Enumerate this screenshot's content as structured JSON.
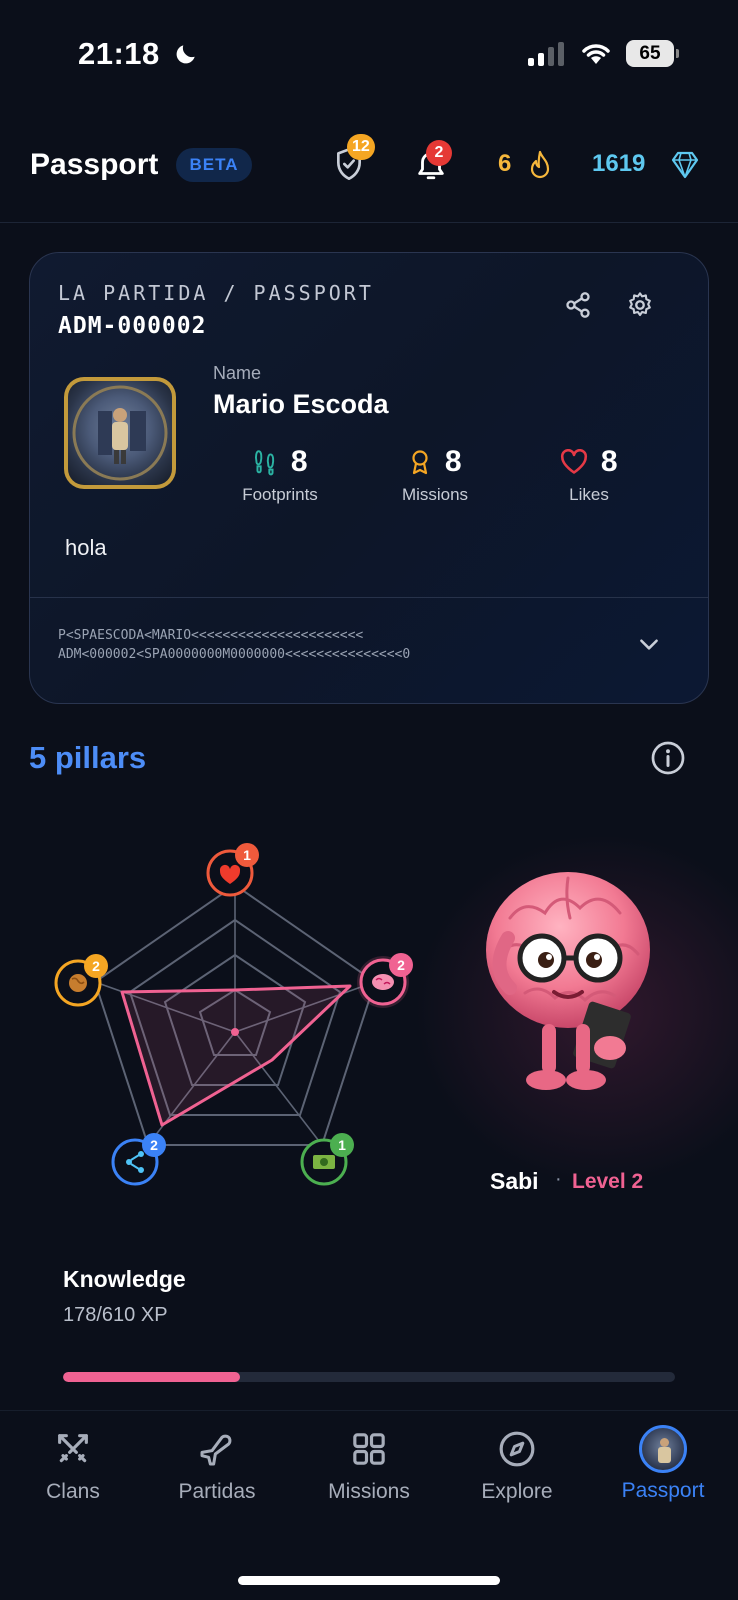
{
  "status_bar": {
    "time": "21:18",
    "battery": "65"
  },
  "header": {
    "title": "Passport",
    "beta": "BETA",
    "shield_badge": "12",
    "notifications_badge": "2",
    "streak": "6",
    "gems": "1619"
  },
  "card": {
    "label": "LA PARTIDA / PASSPORT",
    "id": "ADM-000002",
    "name_label": "Name",
    "name": "Mario Escoda",
    "stats": [
      {
        "value": "8",
        "label": "Footprints"
      },
      {
        "value": "8",
        "label": "Missions"
      },
      {
        "value": "8",
        "label": "Likes"
      }
    ],
    "bio": "hola",
    "mrz_line1": "P<SPAESCODA<MARIO<<<<<<<<<<<<<<<<<<<<<<",
    "mrz_line2": "ADM<000002<SPA0000000M0000000<<<<<<<<<<<<<<<0"
  },
  "pillars": {
    "title": "5 pillars",
    "items": [
      {
        "icon": "heart",
        "level": "1",
        "color": "#ef5a3c"
      },
      {
        "icon": "brain",
        "level": "2",
        "color": "#f06292"
      },
      {
        "icon": "money",
        "level": "1",
        "color": "#4caf50"
      },
      {
        "icon": "share",
        "level": "2",
        "color": "#3b82f6"
      },
      {
        "icon": "globe",
        "level": "2",
        "color": "#f5a623"
      }
    ],
    "character_name": "Sabi",
    "character_separator": "·",
    "character_level": "Level 2"
  },
  "progress": {
    "title": "Knowledge",
    "xp": "178/610 XP",
    "fraction": 0.29
  },
  "nav": [
    {
      "label": "Clans",
      "icon": "swords-icon"
    },
    {
      "label": "Partidas",
      "icon": "plane-icon"
    },
    {
      "label": "Missions",
      "icon": "grid-icon"
    },
    {
      "label": "Explore",
      "icon": "compass-icon"
    },
    {
      "label": "Passport",
      "icon": "avatar-icon"
    }
  ]
}
